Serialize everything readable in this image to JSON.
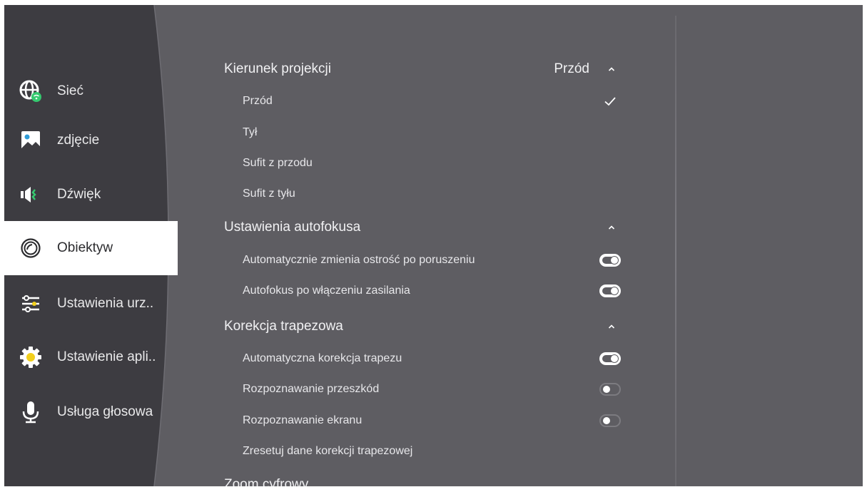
{
  "sidebar": {
    "items": [
      {
        "label": "Sieć",
        "icon": "globe-wifi-icon",
        "active": false
      },
      {
        "label": "zdjęcie",
        "icon": "picture-icon",
        "active": false
      },
      {
        "label": "Dźwięk",
        "icon": "speaker-icon",
        "active": false
      },
      {
        "label": "Obiektyw",
        "icon": "lens-icon",
        "active": true
      },
      {
        "label": "Ustawienia urz..",
        "icon": "sliders-icon",
        "active": false
      },
      {
        "label": "Ustawienie apli..",
        "icon": "gear-icon",
        "active": false
      },
      {
        "label": "Usługa głosowa",
        "icon": "microphone-icon",
        "active": false
      }
    ]
  },
  "settings": {
    "projection": {
      "title": "Kierunek projekcji",
      "value": "Przód",
      "options": [
        "Przód",
        "Tył",
        "Sufit z przodu",
        "Sufit z tyłu"
      ],
      "selected": "Przód"
    },
    "autofocus": {
      "title": "Ustawienia autofokusa",
      "items": [
        {
          "label": "Automatycznie zmienia ostrość po poruszeniu",
          "on": true
        },
        {
          "label": "Autofokus po włączeniu zasilania",
          "on": true
        }
      ]
    },
    "keystone": {
      "title": "Korekcja trapezowa",
      "items": [
        {
          "label": "Automatyczna korekcja trapezu",
          "on": true
        },
        {
          "label": "Rozpoznawanie przeszkód",
          "on": false
        },
        {
          "label": "Rozpoznawanie ekranu",
          "on": false
        }
      ],
      "reset_label": "Zresetuj dane korekcji trapezowej"
    },
    "zoom": {
      "title": "Zoom cyfrowy"
    }
  },
  "colors": {
    "background": "#5e5d62",
    "sidebar": "#3d3c41",
    "active_item": "#ffffff",
    "accent_yellow": "#f2cf1d",
    "accent_green": "#35c96f"
  }
}
